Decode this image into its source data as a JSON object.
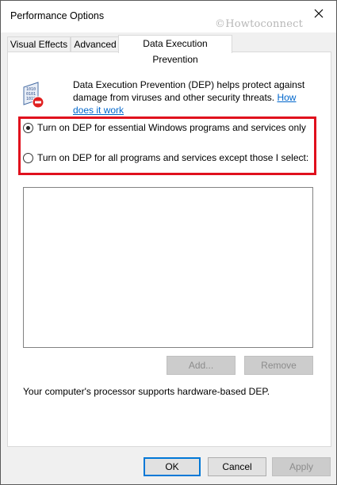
{
  "window": {
    "title": "Performance Options",
    "watermark": "©Howtoconnect"
  },
  "tabs": [
    {
      "label": "Visual Effects",
      "active": false
    },
    {
      "label": "Advanced",
      "active": false
    },
    {
      "label": "Data Execution Prevention",
      "active": true
    }
  ],
  "dep": {
    "description": "Data Execution Prevention (DEP) helps protect against damage from viruses and other security threats.",
    "link_text": "How does it work",
    "options": [
      {
        "label": "Turn on DEP for essential Windows programs and services only",
        "selected": true
      },
      {
        "label": "Turn on DEP for all programs and services except those I select:",
        "selected": false
      }
    ],
    "add_label": "Add...",
    "remove_label": "Remove",
    "support_text": "Your computer's processor supports hardware-based DEP."
  },
  "footer": {
    "ok_label": "OK",
    "cancel_label": "Cancel",
    "apply_label": "Apply"
  },
  "colors": {
    "highlight": "#e0101d",
    "link": "#0066cc",
    "accent": "#0078d7"
  },
  "icons": {
    "close": "close-icon",
    "dep": "dep-shield-icon"
  }
}
